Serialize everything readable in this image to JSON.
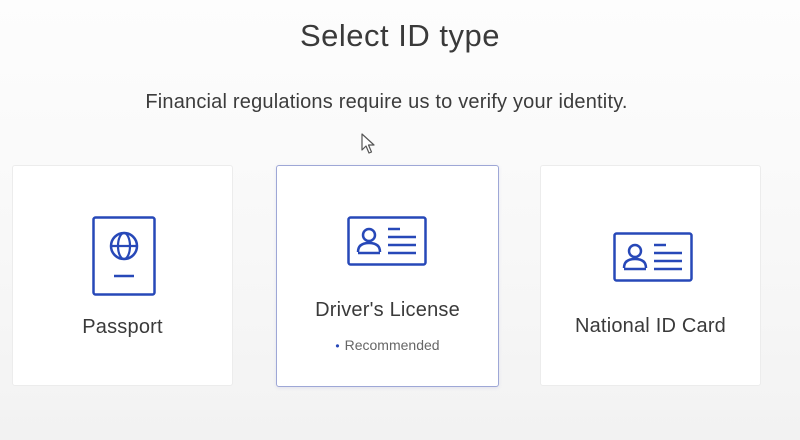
{
  "header": {
    "title": "Select ID type",
    "subtitle": "Financial regulations require us to verify your identity."
  },
  "id_options": [
    {
      "label": "Passport",
      "icon": "passport-icon",
      "selected": false
    },
    {
      "label": "Driver's License",
      "icon": "id-card-icon",
      "selected": true,
      "badge": "Recommended"
    },
    {
      "label": "National ID Card",
      "icon": "id-card-icon",
      "selected": false
    }
  ],
  "colors": {
    "icon_blue": "#2748b8",
    "selected_border": "#9ea7d6",
    "text": "#3a3a3a"
  }
}
